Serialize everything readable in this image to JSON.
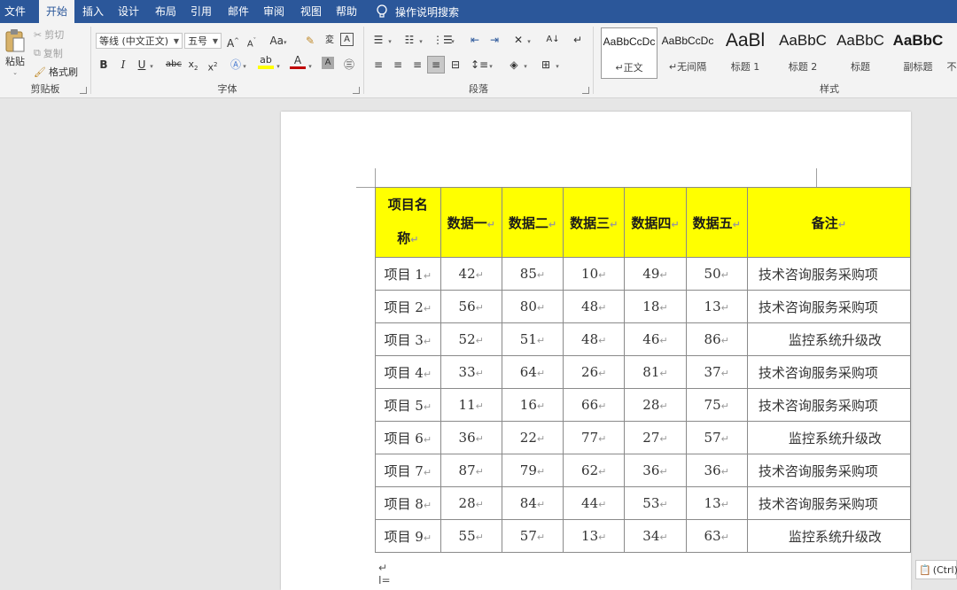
{
  "menubar": {
    "items": [
      {
        "label": "文件"
      },
      {
        "label": "开始"
      },
      {
        "label": "插入"
      },
      {
        "label": "设计"
      },
      {
        "label": "布局"
      },
      {
        "label": "引用"
      },
      {
        "label": "邮件"
      },
      {
        "label": "审阅"
      },
      {
        "label": "视图"
      },
      {
        "label": "帮助"
      }
    ],
    "active_tab": "开始",
    "tell_me": "操作说明搜索"
  },
  "ribbon": {
    "clipboard": {
      "paste": "粘贴",
      "cut": "剪切",
      "copy": "复制",
      "format_painter": "格式刷",
      "group_label": "剪贴板"
    },
    "font": {
      "font_name": "等线 (中文正文)",
      "font_size": "五号",
      "group_label": "字体"
    },
    "paragraph": {
      "group_label": "段落"
    },
    "styles": {
      "group_label": "样式",
      "tiles": [
        {
          "sample": "AaBbCcDc",
          "name": "↵正文"
        },
        {
          "sample": "AaBbCcDc",
          "name": "↵无间隔"
        },
        {
          "sample": "AaBl",
          "name": "标题 1"
        },
        {
          "sample": "AaBbC",
          "name": "标题 2"
        },
        {
          "sample": "AaBbC",
          "name": "标题"
        },
        {
          "sample": "AaBbC",
          "name": "副标题"
        },
        {
          "sample": "",
          "name": "不"
        }
      ]
    }
  },
  "table": {
    "header_bg": "#ffff00",
    "headers": [
      "项目名称",
      "数据一",
      "数据二",
      "数据三",
      "数据四",
      "数据五",
      "备注"
    ],
    "rows": [
      [
        "项目 1",
        "42",
        "85",
        "10",
        "49",
        "50",
        "技术咨询服务采购项"
      ],
      [
        "项目 2",
        "56",
        "80",
        "48",
        "18",
        "13",
        "技术咨询服务采购项"
      ],
      [
        "项目 3",
        "52",
        "51",
        "48",
        "46",
        "86",
        "监控系统升级改"
      ],
      [
        "项目 4",
        "33",
        "64",
        "26",
        "81",
        "37",
        "技术咨询服务采购项"
      ],
      [
        "项目 5",
        "11",
        "16",
        "66",
        "28",
        "75",
        "技术咨询服务采购项"
      ],
      [
        "项目 6",
        "36",
        "22",
        "77",
        "27",
        "57",
        "监控系统升级改"
      ],
      [
        "项目 7",
        "87",
        "79",
        "62",
        "36",
        "36",
        "技术咨询服务采购项"
      ],
      [
        "项目 8",
        "28",
        "84",
        "44",
        "53",
        "13",
        "技术咨询服务采购项"
      ],
      [
        "项目 9",
        "55",
        "57",
        "13",
        "34",
        "63",
        "监控系统升级改"
      ]
    ]
  },
  "paste_options": "(Ctrl)",
  "colors": {
    "brand": "#2b579a",
    "highlight": "#ffff00",
    "font_color": "#c00000"
  }
}
